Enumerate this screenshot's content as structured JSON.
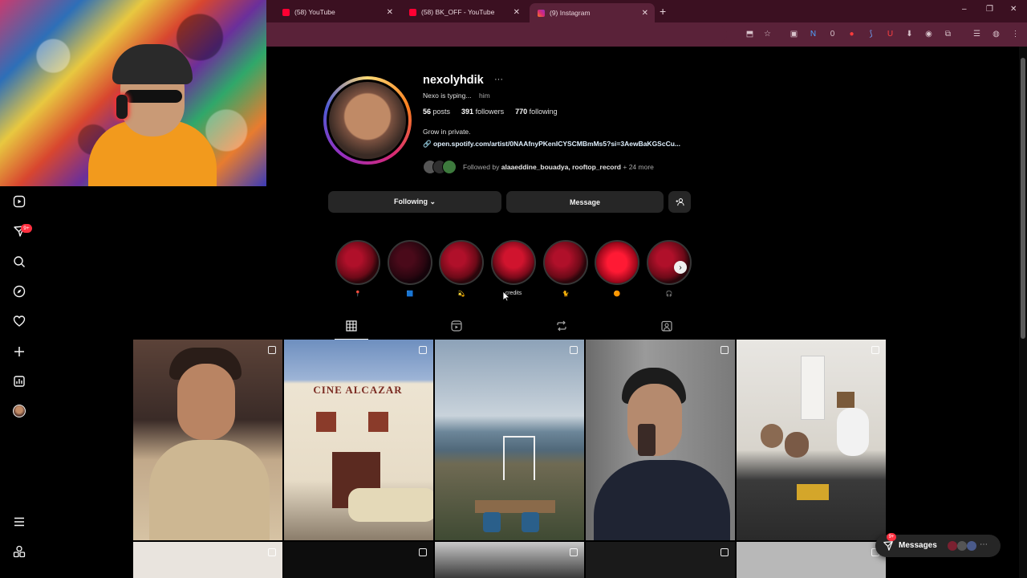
{
  "browser": {
    "tabs": [
      {
        "title": "(58) YouTube",
        "favicon_color": "#ff0033"
      },
      {
        "title": "(58) BK_OFF - YouTube",
        "favicon_color": "#ff0033"
      },
      {
        "title": "(9) Instagram",
        "favicon_color": "#e1306c"
      }
    ],
    "new_tab": "+",
    "window_controls": [
      "–",
      "❐",
      "✕"
    ]
  },
  "left_nav": {
    "items": [
      {
        "name": "reels-icon"
      },
      {
        "name": "messages-icon",
        "badge": "9+"
      },
      {
        "name": "search-icon"
      },
      {
        "name": "explore-icon"
      },
      {
        "name": "notifications-icon"
      },
      {
        "name": "create-icon"
      },
      {
        "name": "dashboard-icon"
      },
      {
        "name": "profile-icon"
      },
      {
        "name": "menu-icon"
      },
      {
        "name": "also-from-meta-icon"
      }
    ]
  },
  "profile": {
    "username": "nexolyhdik",
    "more": "···",
    "note": "Nexo is typing...",
    "pronouns": "him",
    "stats": {
      "posts": "56",
      "posts_label": "posts",
      "followers": "391",
      "followers_label": "followers",
      "following": "770",
      "following_label": "following"
    },
    "bio": "Grow in private.",
    "link": "open.spotify.com/artist/0NAAfnyPKenICYSCMBmMs5?si=3AewBaKGScCu...",
    "followed_by_prefix": "Followed by",
    "followed_by_names": "alaaeddine_bouadya, rooftop_record",
    "followed_by_more": "+ 24 more"
  },
  "actions": {
    "following": "Following ⌄",
    "message": "Message",
    "suggest_icon": "add-person-icon"
  },
  "highlights": [
    {
      "label": "📍"
    },
    {
      "label": "🟦"
    },
    {
      "label": "💫"
    },
    {
      "label": "credits"
    },
    {
      "label": "🐈"
    },
    {
      "label": "🟠"
    },
    {
      "label": "🎧"
    }
  ],
  "profile_tabs": [
    "posts-grid-icon",
    "reels-icon",
    "reposts-icon",
    "tagged-icon"
  ],
  "posts": [
    {
      "desc": "portrait in beige sweater"
    },
    {
      "desc": "CINE ALCAZAR"
    },
    {
      "desc": "sea view with chairs"
    },
    {
      "desc": "mirror selfie"
    },
    {
      "desc": "group in apartment"
    }
  ],
  "posts_text": {
    "cine": "CINE ALCAZAR"
  },
  "messages_button": {
    "label": "Messages",
    "badge": "9+"
  },
  "colors": {
    "background": "#000000",
    "button": "#262626",
    "browser_tabbar": "#3b1021",
    "browser_toolbar": "#5a2239",
    "notification": "#ff3040"
  }
}
